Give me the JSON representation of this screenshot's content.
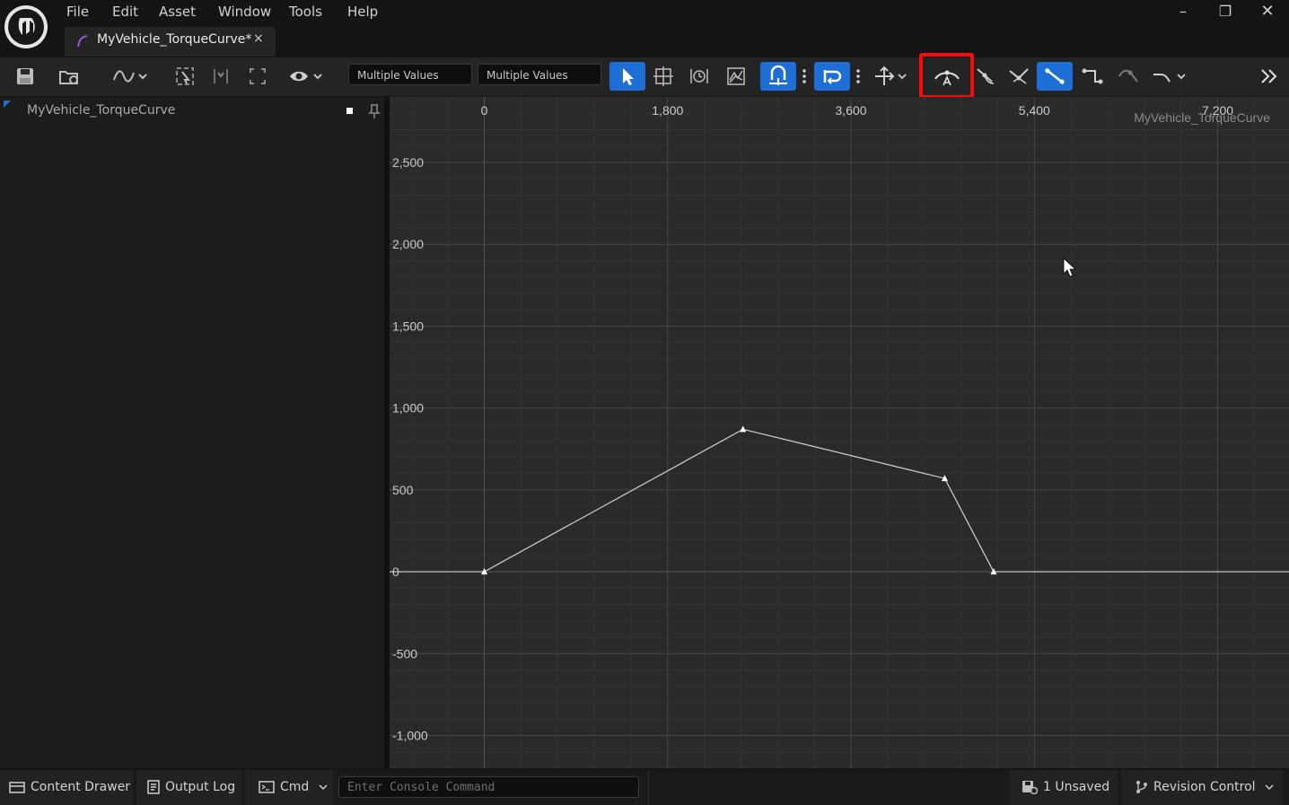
{
  "app": {
    "menu": [
      "File",
      "Edit",
      "Asset",
      "Window",
      "Tools",
      "Help"
    ],
    "tab_title": "MyVehicle_TorqueCurve*",
    "close_glyph": "×"
  },
  "window_controls": {
    "minimize": "–",
    "restore": "❐",
    "close": "✕"
  },
  "toolbar": {
    "time_value": "Multiple Values",
    "value_value": "Multiple Values",
    "icons": [
      "save-icon",
      "browse-asset-icon",
      "curve-view-options-icon",
      "normalize-icon",
      "focus-selection-icon",
      "fit-icon",
      "visibility-icon",
      "select-tool-icon",
      "transform-tool-icon",
      "retime-tool-icon",
      "multi-select-icon",
      "snap-time-icon",
      "snap-value-icon",
      "axis-snap-icon",
      "auto-tangent-icon",
      "user-tangent-icon",
      "break-tangent-icon",
      "linear-tangent-icon",
      "constant-tangent-icon",
      "weighted-tangent-icon",
      "curve-filter-icon",
      "expand-toolbar-icon"
    ]
  },
  "tree": {
    "curve_name": "MyVehicle_TorqueCurve"
  },
  "graph": {
    "watermark": "MyVehicle_TorqueCurve",
    "x_ticks": [
      "0",
      "1,800",
      "3,600",
      "5,400",
      "7,200"
    ],
    "y_ticks": [
      "2,500",
      "2,000",
      "1,500",
      "1,000",
      "500",
      "0",
      "-500",
      "-1,000"
    ]
  },
  "chart_data": {
    "type": "line",
    "title": "MyVehicle_TorqueCurve",
    "xlabel": "",
    "ylabel": "",
    "xlim": [
      -930,
      7900
    ],
    "ylim": [
      -1200,
      2900
    ],
    "x_ticks": [
      0,
      1800,
      3600,
      5400,
      7200
    ],
    "y_ticks": [
      2500,
      2000,
      1500,
      1000,
      500,
      0,
      -500,
      -1000
    ],
    "series": [
      {
        "x": [
          0,
          2540,
          4520,
          5000
        ],
        "y": [
          0,
          870,
          570,
          0
        ]
      }
    ],
    "post_infinity_value": 0,
    "grid": true
  },
  "status": {
    "content_drawer": "Content Drawer",
    "output_log": "Output Log",
    "cmd": "Cmd",
    "console_placeholder": "Enter Console Command",
    "unsaved": "1 Unsaved",
    "revision_control": "Revision Control"
  },
  "colors": {
    "accent": "#1d6fd6",
    "highlight": "#ff0a0a",
    "curve": "#d4d4d4"
  }
}
